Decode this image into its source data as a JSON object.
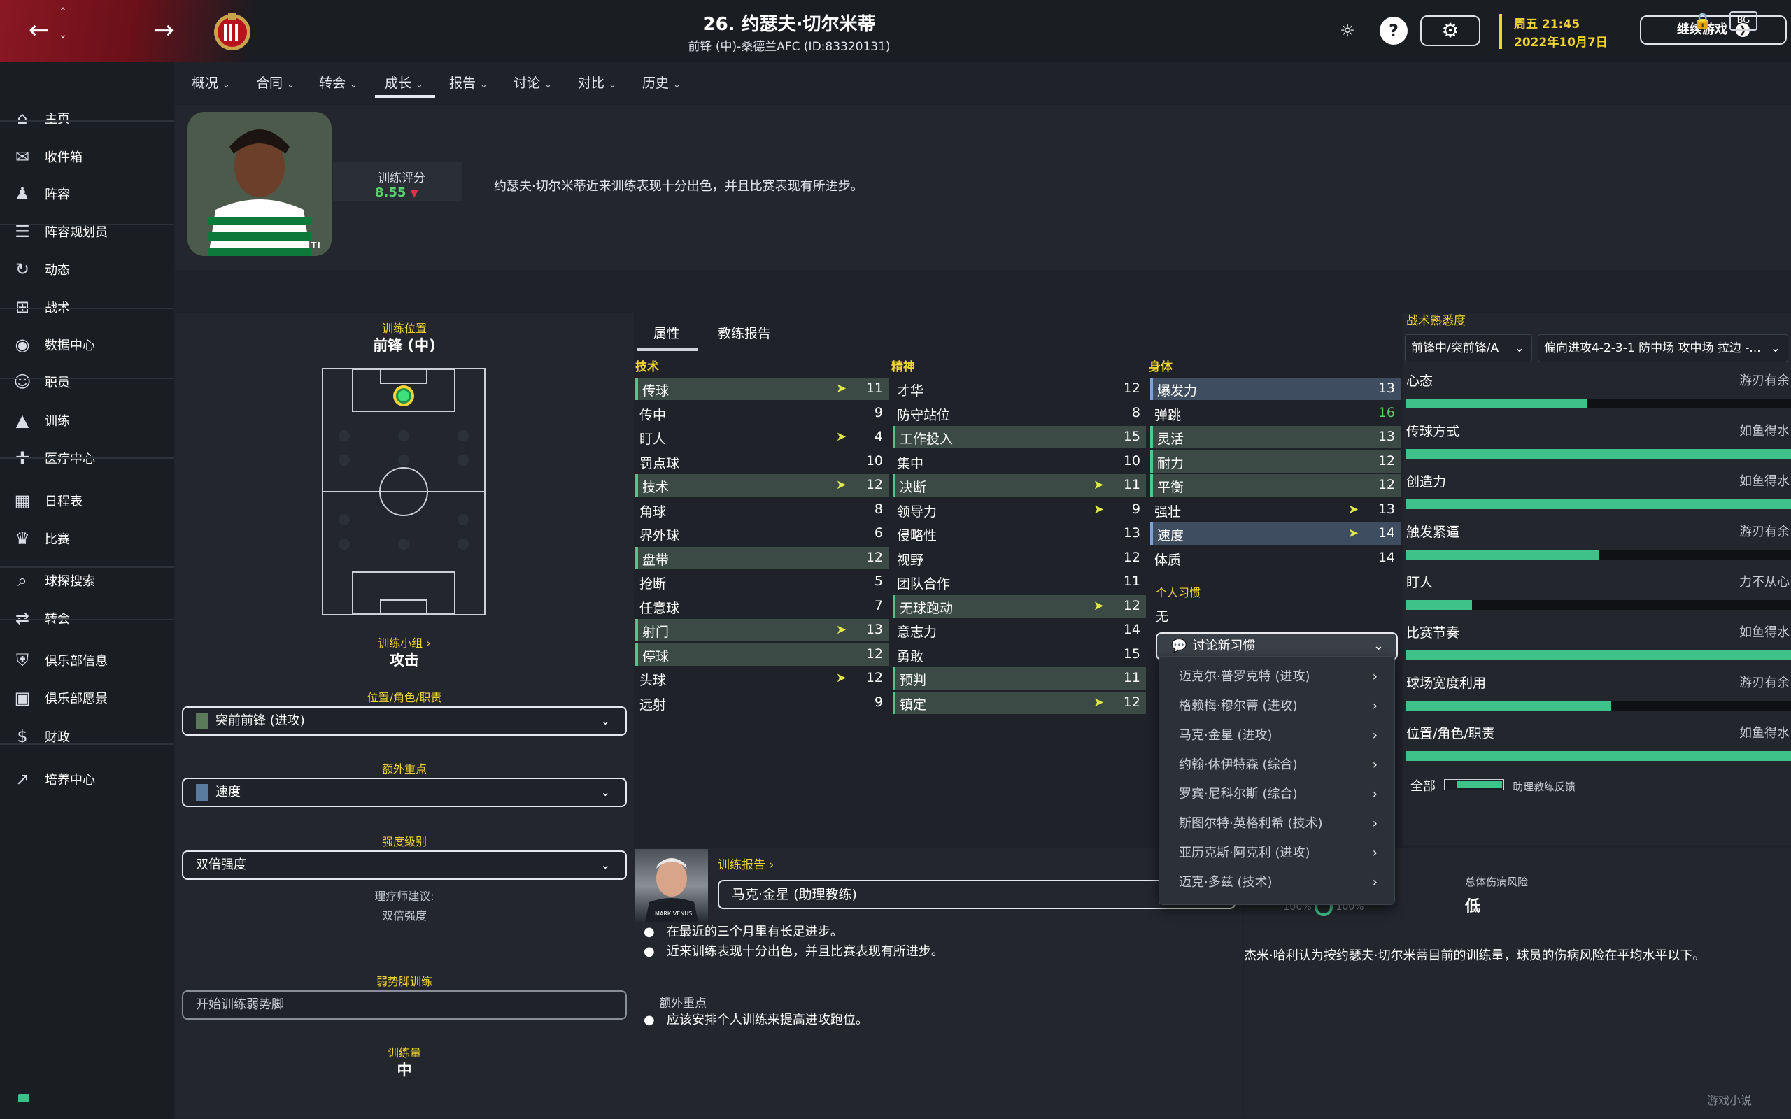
{
  "header": {
    "title": "26. 约瑟夫·切尔米蒂",
    "subtitle": "前锋 (中)-桑德兰AFC (ID:83320131)",
    "day_time": "周五 21:45",
    "date": "2022年10月7日",
    "continue_label": "继续游戏",
    "help_label": "?",
    "accent_color": "#f0d432"
  },
  "sidebar": {
    "items": [
      {
        "label": "主页",
        "icon": "home-icon"
      },
      {
        "label": "收件箱",
        "icon": "inbox-icon"
      },
      {
        "label": "阵容",
        "icon": "shirt-icon"
      },
      {
        "label": "阵容规划员",
        "icon": "clipboard-icon"
      },
      {
        "label": "动态",
        "icon": "refresh-icon"
      },
      {
        "label": "战术",
        "icon": "tactics-icon"
      },
      {
        "label": "数据中心",
        "icon": "data-icon"
      },
      {
        "label": "职员",
        "icon": "staff-icon"
      },
      {
        "label": "训练",
        "icon": "training-icon"
      },
      {
        "label": "医疗中心",
        "icon": "medical-icon"
      },
      {
        "label": "日程表",
        "icon": "calendar-icon"
      },
      {
        "label": "比赛",
        "icon": "trophy-icon"
      },
      {
        "label": "球探搜索",
        "icon": "search-icon"
      },
      {
        "label": "转会",
        "icon": "transfer-icon"
      },
      {
        "label": "俱乐部信息",
        "icon": "shield-icon"
      },
      {
        "label": "俱乐部愿景",
        "icon": "briefcase-icon"
      },
      {
        "label": "财政",
        "icon": "money-icon"
      },
      {
        "label": "培养中心",
        "icon": "chart-icon"
      }
    ]
  },
  "tabs": [
    "概况",
    "合同",
    "转会",
    "成长",
    "报告",
    "讨论",
    "对比",
    "历史"
  ],
  "tabs_extra": {
    "bg_label": "BG"
  },
  "training_rating": {
    "label": "训练评分",
    "value": "8.55"
  },
  "summary": "约瑟夫·切尔米蒂近来训练表现十分出色，并且比赛表现有所进步。",
  "photo_caption": "YOUSSEF CHERMITI",
  "left": {
    "position_label": "训练位置",
    "position_value": "前锋 (中)",
    "group_label": "训练小组 ›",
    "group_value": "攻击",
    "role_label": "位置/角色/职责",
    "role_value": "突前前锋 (进攻)",
    "focus_label": "额外重点",
    "focus_value": "速度",
    "intensity_label": "强度级别",
    "intensity_value": "双倍强度",
    "physio_label": "理疗师建议:",
    "physio_value": "双倍强度",
    "weakfoot_label": "弱势脚训练",
    "weakfoot_value": "开始训练弱势脚",
    "load_label": "训练量",
    "load_value": "中"
  },
  "subtabs": [
    "属性",
    "教练报告"
  ],
  "attributes": {
    "technical_title": "技术",
    "mental_title": "精神",
    "physical_title": "身体",
    "technical": [
      {
        "name": "传球",
        "value": "11",
        "hl": true,
        "arrow": true
      },
      {
        "name": "传中",
        "value": "9",
        "hl": false,
        "arrow": false
      },
      {
        "name": "盯人",
        "value": "4",
        "hl": false,
        "arrow": true
      },
      {
        "name": "罚点球",
        "value": "10",
        "hl": false,
        "arrow": false
      },
      {
        "name": "技术",
        "value": "12",
        "hl": true,
        "arrow": true
      },
      {
        "name": "角球",
        "value": "8",
        "hl": false,
        "arrow": false
      },
      {
        "name": "界外球",
        "value": "6",
        "hl": false,
        "arrow": false
      },
      {
        "name": "盘带",
        "value": "12",
        "hl": true,
        "arrow": false
      },
      {
        "name": "抢断",
        "value": "5",
        "hl": false,
        "arrow": false
      },
      {
        "name": "任意球",
        "value": "7",
        "hl": false,
        "arrow": false
      },
      {
        "name": "射门",
        "value": "13",
        "hl": true,
        "arrow": true
      },
      {
        "name": "停球",
        "value": "12",
        "hl": true,
        "arrow": false
      },
      {
        "name": "头球",
        "value": "12",
        "hl": false,
        "arrow": true
      },
      {
        "name": "远射",
        "value": "9",
        "hl": false,
        "arrow": false
      }
    ],
    "mental": [
      {
        "name": "才华",
        "value": "12",
        "hl": false,
        "arrow": false
      },
      {
        "name": "防守站位",
        "value": "8",
        "hl": false,
        "arrow": false
      },
      {
        "name": "工作投入",
        "value": "15",
        "hl": true,
        "arrow": false
      },
      {
        "name": "集中",
        "value": "10",
        "hl": false,
        "arrow": false
      },
      {
        "name": "决断",
        "value": "11",
        "hl": true,
        "arrow": true
      },
      {
        "name": "领导力",
        "value": "9",
        "hl": false,
        "arrow": true
      },
      {
        "name": "侵略性",
        "value": "13",
        "hl": false,
        "arrow": false
      },
      {
        "name": "视野",
        "value": "12",
        "hl": false,
        "arrow": false
      },
      {
        "name": "团队合作",
        "value": "11",
        "hl": false,
        "arrow": false
      },
      {
        "name": "无球跑动",
        "value": "12",
        "hl": true,
        "arrow": true
      },
      {
        "name": "意志力",
        "value": "14",
        "hl": false,
        "arrow": false
      },
      {
        "name": "勇敢",
        "value": "15",
        "hl": false,
        "arrow": false
      },
      {
        "name": "预判",
        "value": "11",
        "hl": true,
        "arrow": false
      },
      {
        "name": "镇定",
        "value": "12",
        "hl": true,
        "arrow": true
      }
    ],
    "physical": [
      {
        "name": "爆发力",
        "value": "13",
        "hl": "b",
        "arrow": false
      },
      {
        "name": "弹跳",
        "value": "16",
        "hl": false,
        "arrow": false
      },
      {
        "name": "灵活",
        "value": "13",
        "hl": true,
        "arrow": false
      },
      {
        "name": "耐力",
        "value": "12",
        "hl": true,
        "arrow": false
      },
      {
        "name": "平衡",
        "value": "12",
        "hl": true,
        "arrow": false
      },
      {
        "name": "强壮",
        "value": "13",
        "hl": false,
        "arrow": true
      },
      {
        "name": "速度",
        "value": "14",
        "hl": "b",
        "arrow": true
      },
      {
        "name": "体质",
        "value": "14",
        "hl": false,
        "arrow": false
      }
    ]
  },
  "habits": {
    "title": "个人习惯",
    "value": "无",
    "button": "讨论新习惯",
    "menu": [
      "迈克尔·普罗克特 (进攻)",
      "格赖梅·穆尔蒂 (进攻)",
      "马克·金星 (进攻)",
      "约翰·休伊特森 (综合)",
      "罗宾·尼科尔斯 (综合)",
      "斯图尔特·英格利希 (技术)",
      "亚历克斯·阿克利 (进攻)",
      "迈克·多兹 (技术)"
    ]
  },
  "familiarity": {
    "title": "战术熟悉度",
    "position_select": "前锋中/突前锋/A",
    "tactic_select": "偏向进攻4-2-3-1 防中场 攻中场 拉边 -...",
    "items": [
      {
        "label": "心态",
        "status": "游刃有余",
        "fraction": 0.47
      },
      {
        "label": "传球方式",
        "status": "如鱼得水",
        "fraction": 1.0
      },
      {
        "label": "创造力",
        "status": "如鱼得水",
        "fraction": 1.0
      },
      {
        "label": "触发紧逼",
        "status": "游刃有余",
        "fraction": 0.5
      },
      {
        "label": "盯人",
        "status": "力不从心",
        "fraction": 0.17
      },
      {
        "label": "比赛节奏",
        "status": "如鱼得水",
        "fraction": 1.0
      },
      {
        "label": "球场宽度利用",
        "status": "游刃有余",
        "fraction": 0.53
      },
      {
        "label": "位置/角色/职责",
        "status": "如鱼得水",
        "fraction": 1.0
      }
    ],
    "all_label": "全部",
    "assistant_label": "助理教练反馈"
  },
  "report": {
    "title": "训练报告 ›",
    "coach": "马克·金星 (助理教练)",
    "bullets": [
      "在最近的三个月里有长足进步。",
      "近来训练表现十分出色，并且比赛表现有所进步。"
    ],
    "extra_title": "额外重点",
    "extra_bullet": "应该安排个人训练来提高进攻跑位。",
    "coach_shirt_text": "MARK VENUS"
  },
  "injury": {
    "risk_label": "总体伤病风险",
    "risk_value": "低",
    "load_pct": "100%",
    "comment": "杰米·哈利认为按约瑟夫·切尔米蒂目前的训练量，球员的伤病风险在平均水平以下。"
  },
  "watermark": "游戏小说"
}
